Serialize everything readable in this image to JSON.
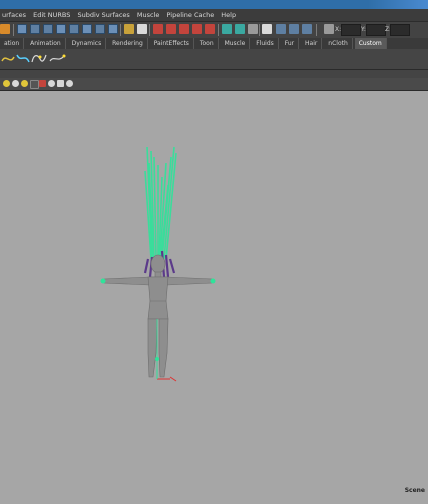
{
  "menubar": {
    "items": [
      "urfaces",
      "Edit NURBS",
      "Subdiv Surfaces",
      "Muscle",
      "Pipeline Cache",
      "Help"
    ]
  },
  "statusline": {
    "x_label": "X:",
    "y_label": "Y:",
    "z_label": "Z:"
  },
  "shelf": {
    "tabs": [
      "ation",
      "Animation",
      "Dynamics",
      "Rendering",
      "PaintEffects",
      "Toon",
      "Muscle",
      "Fluids",
      "Fur",
      "Hair",
      "nCloth",
      "Custom"
    ],
    "active_tab": "Custom"
  },
  "viewport": {
    "camera_label": "Scene"
  },
  "colors": {
    "accent_green": "#2fe39a",
    "joint_purple": "#5b3a8a",
    "mesh_gray": "#8e8e8e",
    "viewport_bg": "#a6a6a6"
  }
}
